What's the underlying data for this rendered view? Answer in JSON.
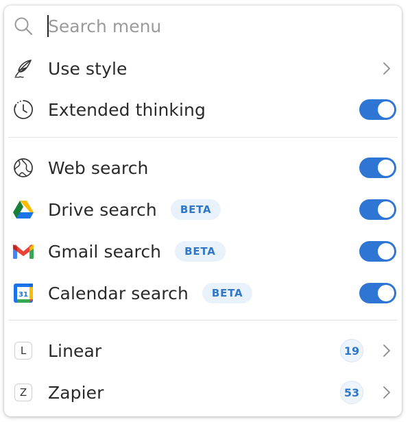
{
  "search": {
    "placeholder": "Search menu",
    "value": ""
  },
  "section1": {
    "items": [
      {
        "label": "Use style",
        "icon": "feather-icon",
        "control": "chevron"
      },
      {
        "label": "Extended thinking",
        "icon": "clock-icon",
        "control": "toggle",
        "on": true
      }
    ]
  },
  "section2": {
    "items": [
      {
        "label": "Web search",
        "icon": "globe-icon",
        "control": "toggle",
        "on": true
      },
      {
        "label": "Drive search",
        "icon": "google-drive-icon",
        "badge": "BETA",
        "control": "toggle",
        "on": true
      },
      {
        "label": "Gmail search",
        "icon": "gmail-icon",
        "badge": "BETA",
        "control": "toggle",
        "on": true
      },
      {
        "label": "Calendar search",
        "icon": "google-calendar-icon",
        "icon_text": "31",
        "badge": "BETA",
        "control": "toggle",
        "on": true
      }
    ]
  },
  "section3": {
    "items": [
      {
        "label": "Linear",
        "icon_letter": "L",
        "count": "19",
        "control": "chevron"
      },
      {
        "label": "Zapier",
        "icon_letter": "Z",
        "count": "53",
        "control": "chevron"
      }
    ]
  },
  "colors": {
    "toggle_on": "#2f76d4",
    "beta_bg": "#e9f1fb",
    "beta_text": "#2f78c8",
    "text": "#2a2a2a"
  }
}
